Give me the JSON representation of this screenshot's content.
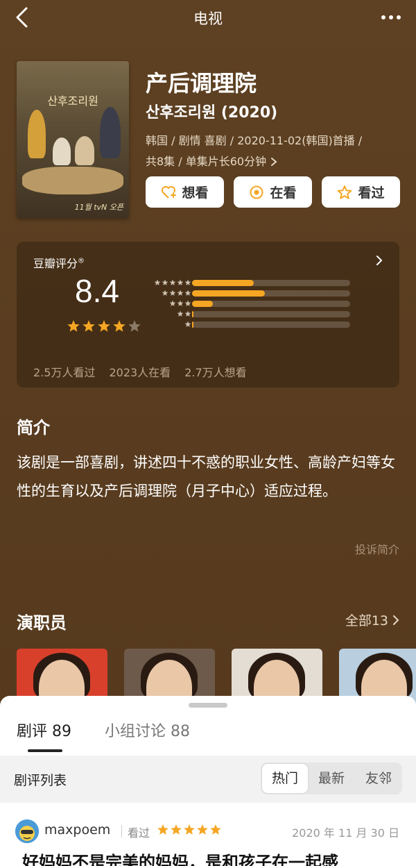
{
  "header": {
    "title": "电视"
  },
  "show": {
    "title_cn": "产后调理院",
    "title_orig": "산후조리원 (2020)",
    "meta_line1": "韩国 / 剧情 喜剧 / 2020-11-02(韩国)首播 /",
    "meta_line2": "共8集 / 单集片长60分钟",
    "poster_title": "산후조리원",
    "poster_tag": "11월 tvN 오픈"
  },
  "actions": {
    "want": "想看",
    "watching": "在看",
    "watched": "看过"
  },
  "rating": {
    "label": "豆瓣评分",
    "label_mark": "®",
    "score": "8.4",
    "stars": 4,
    "distribution": [
      {
        "stars": 5,
        "fraction": 0.39
      },
      {
        "stars": 4,
        "fraction": 0.46
      },
      {
        "stars": 3,
        "fraction": 0.13
      },
      {
        "stars": 2,
        "fraction": 0.01
      },
      {
        "stars": 1,
        "fraction": 0.01
      }
    ],
    "watched_count": "2.5万人看过",
    "watching_count": "2023人在看",
    "want_count": "2.7万人想看"
  },
  "intro": {
    "heading": "简介",
    "text": "该剧是一部喜剧，讲述四十不惑的职业女性、高龄产妇等女性的生育以及产后调理院（月子中心）适应过程。",
    "report_link": "投诉简介"
  },
  "cast": {
    "heading": "演职员",
    "all_label": "全部13",
    "members": [
      {
        "bg": "#d8402c"
      },
      {
        "bg": "#6e5a4a"
      },
      {
        "bg": "#e3ddd4"
      },
      {
        "bg": "#b9cfe0"
      }
    ]
  },
  "sheet": {
    "tabs": [
      {
        "label": "剧评",
        "count": "89",
        "active": true
      },
      {
        "label": "小组讨论",
        "count": "88",
        "active": false
      }
    ],
    "list_label": "剧评列表",
    "sort_options": [
      "热门",
      "最新",
      "友邻"
    ],
    "sort_selected": "热门"
  },
  "review": {
    "user": "maxpoem",
    "status": "看过",
    "stars": 5,
    "date": "2020 年 11 月 30 日",
    "title": "好妈妈不是完美的妈妈，是和孩子在一起感"
  },
  "colors": {
    "accent": "#f5a623",
    "background": "#5a3d20"
  }
}
